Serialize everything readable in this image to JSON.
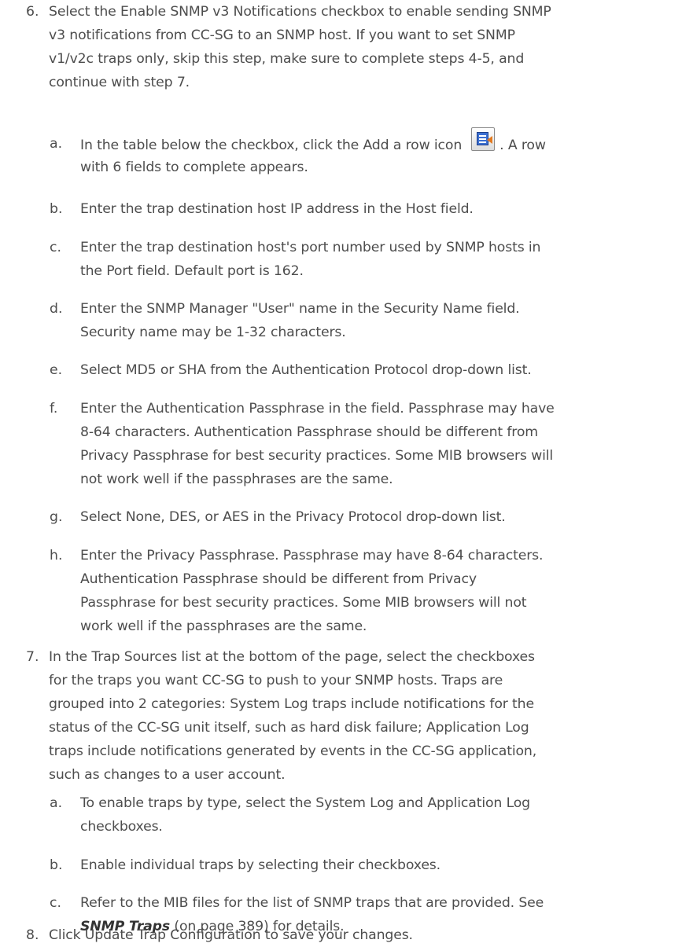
{
  "steps": [
    {
      "num": "6.",
      "lines": [
        "Select the Enable SNMP v3 Notifications checkbox to enable sending SNMP",
        "v3 notifications from CC-SG to an SNMP host. If you want to set SNMP",
        "v1/v2c traps only, skip this step, make sure to complete steps 4-5, and",
        "continue with step 7."
      ],
      "substeps": [
        {
          "letter": "a.",
          "lines": [
            "In the table below the checkbox, click the Add a row icon",
            ". A row",
            "with 6 fields to complete appears."
          ],
          "icon": "add-row-icon"
        },
        {
          "letter": "b.",
          "lines": [
            "Enter the trap destination host IP address in the Host field."
          ]
        },
        {
          "letter": "c.",
          "lines": [
            "Enter the trap destination host's port number used by SNMP hosts in",
            "the Port field. Default port is 162."
          ]
        },
        {
          "letter": "d.",
          "lines": [
            "Enter the SNMP Manager \"User\" name in the Security Name field.",
            "Security name may be 1-32 characters."
          ]
        },
        {
          "letter": "e.",
          "lines": [
            "Select MD5 or SHA from the Authentication Protocol drop-down list."
          ]
        },
        {
          "letter": "f.",
          "lines": [
            "Enter the Authentication Passphrase in the field. Passphrase may have",
            "8-64 characters. Authentication Passphrase should be different from",
            "Privacy Passphrase for best security practices. Some MIB browsers will",
            "not work well if the passphrases are the same."
          ]
        },
        {
          "letter": "g.",
          "lines": [
            "Select None, DES, or AES in the Privacy Protocol drop-down list."
          ]
        },
        {
          "letter": "h.",
          "lines": [
            "Enter the Privacy Passphrase. Passphrase may have 8-64 characters.",
            "Authentication Passphrase should be different from Privacy",
            "Passphrase for best security practices. Some MIB browsers will not",
            "work well if the passphrases are the same."
          ]
        }
      ]
    },
    {
      "num": "7.",
      "lines": [
        "In the Trap Sources list at the bottom of the page, select the checkboxes",
        "for the traps you want CC-SG to push to your SNMP hosts. Traps are",
        "grouped into 2 categories: System Log traps include notifications for the",
        "status of the CC-SG unit itself, such as hard disk failure; Application Log",
        "traps include notifications generated by events in the CC-SG application,",
        "such as changes to a user account."
      ],
      "substeps": [
        {
          "letter": "a.",
          "lines": [
            "To enable traps by type, select the System Log and Application Log",
            "checkboxes."
          ]
        },
        {
          "letter": "b.",
          "lines": [
            "Enable individual traps by selecting their checkboxes."
          ]
        },
        {
          "letter": "c.",
          "lines": [
            "Refer to the MIB files for the list of SNMP traps that are provided. See",
            "SNMP Traps",
            " (on page 389) for details."
          ],
          "link": "SNMP Traps"
        }
      ]
    },
    {
      "num": "8.",
      "lines": [
        "Click Update Trap Configuration to save your changes."
      ]
    }
  ]
}
